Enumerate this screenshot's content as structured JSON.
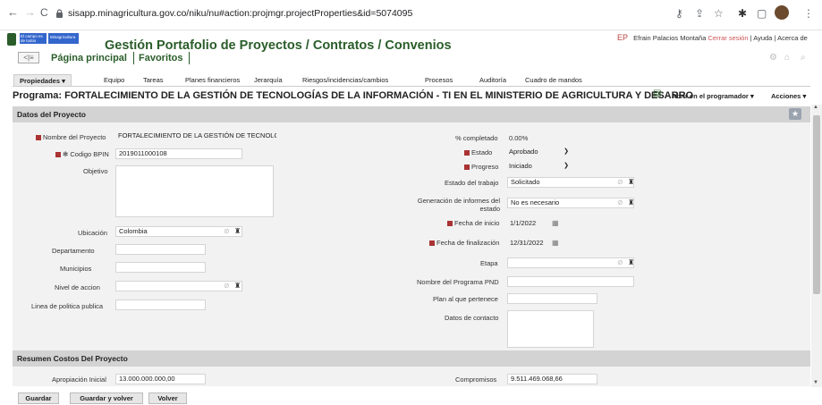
{
  "browser": {
    "url": "sisapp.minagricultura.gov.co/niku/nu#action:projmgr.projectProperties&id=5074095",
    "back": "←",
    "forward": "→",
    "reload": "C"
  },
  "header": {
    "logo_text_1": "El campo\nes de todos",
    "logo_text_2": "Minagricultura",
    "title": "Gestión Portafolio de Proyectos / Contratos / Convenios",
    "user_initials": "EP",
    "user_name": "Efrain Palacios Montaña",
    "logout": "Cerrar sesión",
    "help": "Ayuda",
    "about": "Acerca de",
    "home_link": "Página principal",
    "favorites_link": "Favoritos"
  },
  "tabs": [
    "Propiedades",
    "Equipo",
    "Tareas",
    "Planes financieros",
    "Jerarquía",
    "Riesgos/incidencias/cambios",
    "Procesos",
    "Auditoría",
    "Cuadro de mandos"
  ],
  "program": {
    "title": "Programa: FORTALECIMIENTO DE LA GESTIÓN DE TECNOLOGÍAS DE LA INFORMACIÓN - TI EN EL MINISTERIO DE AGRICULTURA Y DESARRO",
    "open_in_scheduler": "Abrir en el programador",
    "actions": "Acciones"
  },
  "section1": {
    "title": "Datos del Proyecto"
  },
  "left_fields": {
    "nombre_label": "Nombre del Proyecto",
    "nombre_value": "FORTALECIMIENTO DE LA GESTIÓN DE TECNOLC",
    "bpin_label": "Codigo BPIN",
    "bpin_star": "✻",
    "bpin_value": "2019011000108",
    "objetivo_label": "Objetivo",
    "ubicacion_label": "Ubicación",
    "ubicacion_value": "Colombia",
    "departamento_label": "Departamento",
    "municipios_label": "Municipios",
    "nivel_label": "Nivel de accion",
    "linea_label": "Linea de politica publica"
  },
  "right_fields": {
    "completado_label": "% completado",
    "completado_value": "0.00%",
    "estado_label": "Estado",
    "estado_value": "Aprobado",
    "progreso_label": "Progreso",
    "progreso_value": "Iniciado",
    "estado_trabajo_label": "Estado del trabajo",
    "estado_trabajo_value": "Solicitado",
    "informes_label_1": "Generación de informes del",
    "informes_label_2": "estado",
    "informes_value": "No es necesario",
    "inicio_label": "Fecha de inicio",
    "inicio_value": "1/1/2022",
    "fin_label": "Fecha de finalización",
    "fin_value": "12/31/2022",
    "etapa_label": "Etapa",
    "pnd_label": "Nombre del Programa PND",
    "plan_label": "Plan al que pertenece",
    "contacto_label": "Datos de contacto"
  },
  "section2": {
    "title": "Resumen Costos Del Proyecto",
    "apropiacion_label": "Apropiación Inicial",
    "apropiacion_value": "13.000.000.000,00",
    "compromisos_label": "Compromisos",
    "compromisos_value": "9.511.469.068,66"
  },
  "buttons": {
    "save": "Guardar",
    "save_back": "Guardar y volver",
    "back": "Volver"
  }
}
